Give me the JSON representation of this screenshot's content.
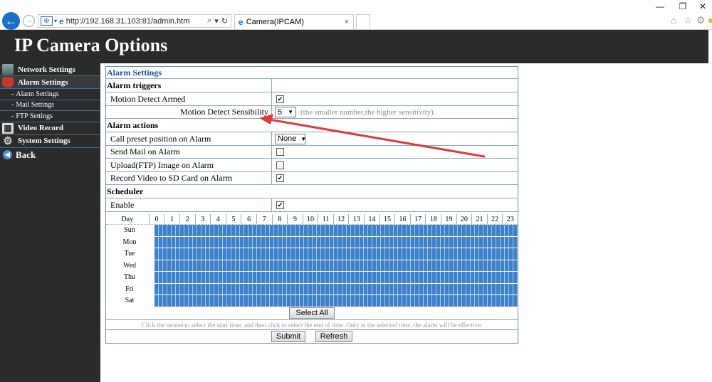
{
  "browser": {
    "url": "http://192.168.31.103:81/admin.htm",
    "tab_title": "Camera(IPCAM)",
    "search_glyph": "⌕",
    "dropdown_glyph": "▾",
    "refresh_glyph": "↻",
    "tab_close": "×"
  },
  "header": {
    "title": "IP Camera Options"
  },
  "sidebar": {
    "network": "Network Settings",
    "alarm": "Alarm Settings",
    "sub_items": [
      "Alarm Settings",
      "Mail Settings",
      "FTP Settings"
    ],
    "video": "Video Record",
    "system": "System Settings",
    "back": "Back"
  },
  "panel": {
    "title": "Alarm Settings",
    "triggers_header": "Alarm triggers",
    "motion_armed_label": "Motion Detect Armed",
    "motion_armed_checked": true,
    "sensibility_label": "Motion Detect Sensibility",
    "sensibility_value": "5",
    "sensibility_hint": "(the smaller number,the higher sensitivity)",
    "actions_header": "Alarm actions",
    "preset_label": "Call preset position on Alarm",
    "preset_value": "None",
    "send_mail_label": "Send Mail on Alarm",
    "send_mail_checked": false,
    "upload_label": "Upload(FTP) Image on Alarm",
    "upload_checked": false,
    "record_label": "Record Video to SD Card on Alarm",
    "record_checked": true,
    "scheduler_header": "Scheduler",
    "enable_label": "Enable",
    "enable_checked": true
  },
  "schedule": {
    "day_header": "Day",
    "hours": [
      "0",
      "1",
      "2",
      "3",
      "4",
      "5",
      "6",
      "7",
      "8",
      "9",
      "10",
      "11",
      "12",
      "13",
      "14",
      "15",
      "16",
      "17",
      "18",
      "19",
      "20",
      "21",
      "22",
      "23"
    ],
    "days": [
      "Sun",
      "Mon",
      "Tue",
      "Wed",
      "Thu",
      "Fri",
      "Sat"
    ],
    "select_all": "Select All",
    "instruction": "Click the mouse to select the start time, and then click to select the end of time. Only in the selected time, the alarm will be effective."
  },
  "buttons": {
    "submit": "Submit",
    "refresh": "Refresh"
  },
  "colors": {
    "schedule_fill": "#3d82c9",
    "annotation_arrow": "#e03a3a",
    "header_bg": "#2b2b2b"
  }
}
